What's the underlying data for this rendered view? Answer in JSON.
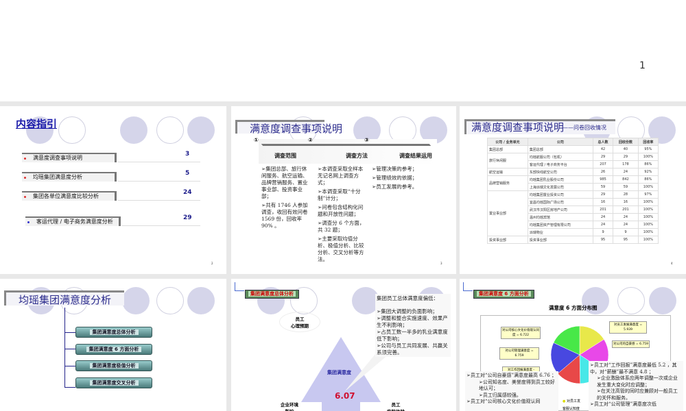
{
  "slide1": {
    "page": "1"
  },
  "slide2": {
    "title": "内容指引",
    "items": [
      {
        "label": "满意度调查事项说明",
        "page": "3"
      },
      {
        "label": "均瑶集团满意度分析",
        "page": "5"
      },
      {
        "label": "集团各单位满意度比较分析",
        "page": "24"
      },
      {
        "label": "客运代理 / 电子商务满意度分析",
        "page": "29"
      }
    ],
    "page": "2"
  },
  "slide3": {
    "title": "满意度调查事项说明",
    "steps": [
      {
        "num": "①",
        "label": "调查范围"
      },
      {
        "num": "②",
        "label": "调查方法"
      },
      {
        "num": "③",
        "label": "调查结果运用"
      }
    ],
    "col1": [
      "➢集团总部、旅行休闲服务、航空运输、品牌营销服务、置业事业部、投资事业部；",
      "➢共有 1746 人参加调查，收回有效问卷 1569 份，回收率 90% 。"
    ],
    "col2": [
      "➢本调查采取全样本无记名网上调查方式；",
      "➢本调查采取“十分制”计分；",
      "➢问卷包含结构化问题和开放性问题；",
      "➢调查分 6 个方面，共 32 题；",
      "➢主要采取均值分析、极值分析、比较分析、交叉分析等方法。"
    ],
    "col3": [
      "➢管理决策的参考；",
      "➢管理绩效的依据；",
      "➢员工发展的参考。"
    ],
    "page": "3"
  },
  "slide4": {
    "title": "满意度调查事项说明",
    "subtitle": "——问卷回收情况",
    "headers": [
      "公司 / 业务单元",
      "公司",
      "总人数",
      "回收份数",
      "回收率"
    ],
    "rows": [
      {
        "unit": "集团总部",
        "span": 1,
        "company": "集团总部",
        "total": "42",
        "returned": "40",
        "rate": "95%"
      },
      {
        "unit": "旅行休闲服",
        "span": 2,
        "company": "均瑶航服公司（包机）",
        "total": "29",
        "returned": "29",
        "rate": "100%"
      },
      {
        "unit": "",
        "span": 0,
        "company": "客运代理 / 电子商务平台",
        "total": "207",
        "returned": "178",
        "rate": "86%"
      },
      {
        "unit": "航空运输",
        "span": 1,
        "company": "东部快线航空公司",
        "total": "26",
        "returned": "24",
        "rate": "92%"
      },
      {
        "unit": "品牌营销服务",
        "span": 2,
        "company": "均瑶集团乳业股份公司",
        "total": "985",
        "returned": "842",
        "rate": "86%"
      },
      {
        "unit": "",
        "span": 0,
        "company": "上海派瑞文化发展公司",
        "total": "59",
        "returned": "59",
        "rate": "100%"
      },
      {
        "unit": "置业事业部",
        "span": 6,
        "company": "均瑶集团置业投资公司",
        "total": "29",
        "returned": "28",
        "rate": "97%"
      },
      {
        "unit": "",
        "span": 0,
        "company": "宜昌均瑶国际广场公司",
        "total": "16",
        "returned": "16",
        "rate": "100%"
      },
      {
        "unit": "",
        "span": 0,
        "company": "武汉市汉阳区房地产公司",
        "total": "201",
        "returned": "201",
        "rate": "100%"
      },
      {
        "unit": "",
        "span": 0,
        "company": "温州均瑶宾馆",
        "total": "24",
        "returned": "24",
        "rate": "100%"
      },
      {
        "unit": "",
        "span": 0,
        "company": "均瑶集团资产管理有限公司",
        "total": "24",
        "returned": "24",
        "rate": "100%"
      },
      {
        "unit": "",
        "span": 0,
        "company": "派瑞物业",
        "total": "9",
        "returned": "9",
        "rate": "100%"
      },
      {
        "unit": "投资事业部",
        "span": 1,
        "company": "投资事业部",
        "total": "95",
        "returned": "95",
        "rate": "100%"
      }
    ],
    "page": "4"
  },
  "slide5": {
    "title": "均瑶集团满意度分析",
    "buttons": [
      "集团满意度总体分析",
      "集团满意度 6 方面分析",
      "集团满意度极值分析",
      "集团满意度交叉分析"
    ]
  },
  "slide6": {
    "label": "集团满意度总体分析",
    "top": "员工\n心理预期",
    "center": "集团满意度",
    "score": "6.07",
    "left": "企业环境\n影响",
    "right": "员工\n实际体验",
    "note_title": "集团员工总体满意度偏低：",
    "notes": [
      "➢集团大调整的负面影响；",
      "➢调整和整合实施速度、效果产生不利影响；",
      "➢占员工数一半多的乳业满意度低下影响；",
      "➢公司与员工共同发展、共赢关系须完善。"
    ]
  },
  "slide7": {
    "label": "集团满意度 6 方面分析",
    "chart_title": "满意度 6 方面分布图",
    "chart_data": {
      "type": "pie",
      "title": "满意度 6 方面分布图",
      "labels": [
        "对员工发展满意度 = 5.939",
        "对公司的自豪感 = 6.759",
        "对公司管理满意度 = 6.759",
        "对公司核心文化价值观认同度 = 6.722",
        "对工作回报满意度 -"
      ],
      "slices": [
        {
          "name": "对员工发展满意度",
          "value": 5.939,
          "color": "#e8e84a"
        },
        {
          "name": "对公司的自豪感",
          "value": 6.759,
          "color": "#e848e8"
        },
        {
          "name": "对员工",
          "value": 5.8,
          "color": "#48e8e8"
        },
        {
          "name": "对工作回报满意度",
          "value": 5.2,
          "color": "#e84848"
        },
        {
          "name": "对公司管理满意度",
          "value": 6.759,
          "color": "#4848e0"
        },
        {
          "name": "对公司核心文化价值观认同度",
          "value": 6.722,
          "color": "#48e848"
        }
      ]
    },
    "left_notes": [
      "➢员工对“公司自豪感”满意度最高 6.76 ；",
      "➢公司知名度、美誉度得到员工较好地认可；",
      "➢员工归属感较强。",
      "➢员工对“公司核心文化价值观认同"
    ],
    "right_notes": [
      "➢员工对“工作回报”满意度最低 5.2 ，其中，对“薪酬”最不满意 4.8 ；",
      "➢企业激励体系应两年调整一次或企业发生重大变化时应调整；",
      "➢在关注高管的同时应兼顾对一般员工的关怀和服务。",
      "➢员工对“公司管理”满意度次低"
    ],
    "legend": [
      "对员工发",
      "客服认知度"
    ]
  }
}
